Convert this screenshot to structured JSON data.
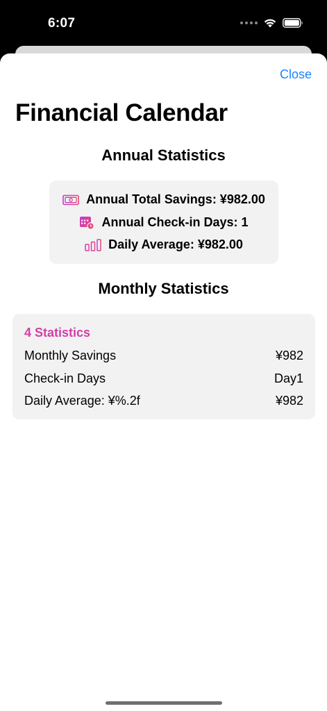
{
  "status_bar": {
    "time": "6:07"
  },
  "header": {
    "close_label": "Close",
    "title": "Financial Calendar"
  },
  "annual": {
    "section_title": "Annual Statistics",
    "rows": [
      {
        "icon": "money-icon",
        "text": "Annual Total Savings: ¥982.00"
      },
      {
        "icon": "calendar-icon",
        "text": "Annual Check-in Days: 1"
      },
      {
        "icon": "bar-chart-icon",
        "text": "Daily Average: ¥982.00"
      }
    ]
  },
  "monthly": {
    "section_title": "Monthly Statistics",
    "month_label": "4 Statistics",
    "rows": [
      {
        "label": "Monthly Savings",
        "value": "¥982"
      },
      {
        "label": "Check-in Days",
        "value": "Day1"
      },
      {
        "label": "Daily Average: ¥%.2f",
        "value": "¥982"
      }
    ]
  },
  "colors": {
    "accent_link": "#1a84ff",
    "accent_pink": "#d33fa6",
    "card_background": "#f2f2f3"
  }
}
